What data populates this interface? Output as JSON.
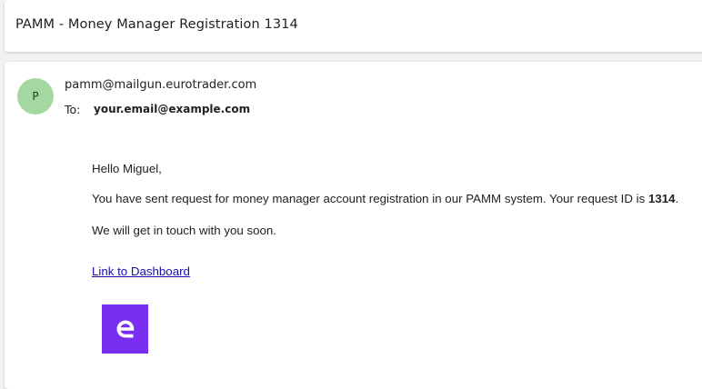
{
  "subject": "PAMM - Money Manager Registration 1314",
  "email": {
    "avatar_letter": "P",
    "sender": "pamm@mailgun.eurotrader.com",
    "to_label": "To:",
    "to_address": "your.email@example.com",
    "greeting": "Hello Miguel,",
    "para1_before": "You have sent request for money manager account registration in our PAMM system. Your request ID is ",
    "request_id": "1314",
    "para1_after": ".",
    "para2": "We will get in touch with you soon.",
    "link_text": "Link to Dashboard",
    "logo": "eurotrader-logo-icon",
    "brand_color": "#7a2ef2"
  }
}
